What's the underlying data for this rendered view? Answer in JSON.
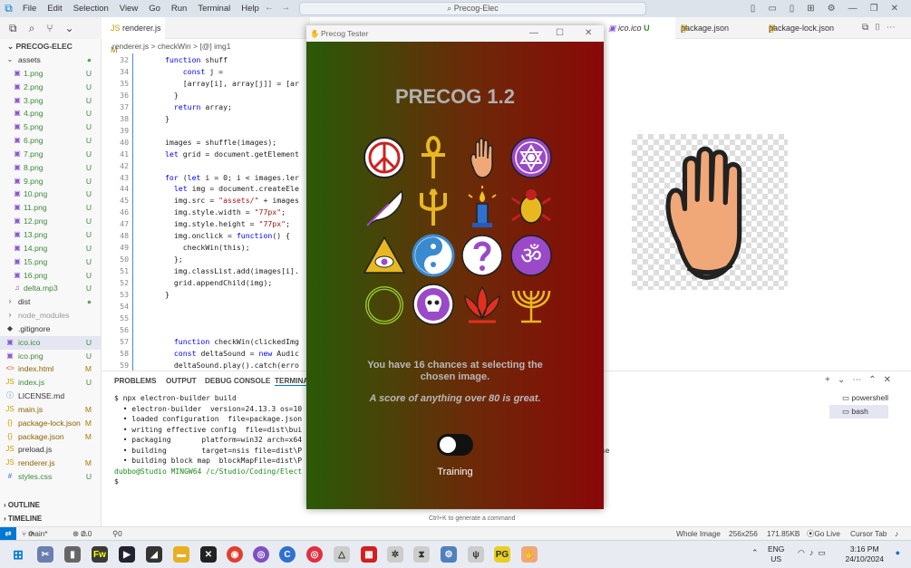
{
  "menubar": {
    "items": [
      "File",
      "Edit",
      "Selection",
      "View",
      "Go",
      "Run",
      "Terminal",
      "Help"
    ],
    "search": "Precog-Elec"
  },
  "sidebar": {
    "title": "PRECOG-ELEC",
    "items": [
      {
        "name": "assets",
        "type": "folder",
        "status": "●"
      },
      {
        "name": "1.png",
        "type": "img",
        "status": "U"
      },
      {
        "name": "2.png",
        "type": "img",
        "status": "U"
      },
      {
        "name": "3.png",
        "type": "img",
        "status": "U"
      },
      {
        "name": "4.png",
        "type": "img",
        "status": "U"
      },
      {
        "name": "5.png",
        "type": "img",
        "status": "U"
      },
      {
        "name": "6.png",
        "type": "img",
        "status": "U"
      },
      {
        "name": "7.png",
        "type": "img",
        "status": "U"
      },
      {
        "name": "8.png",
        "type": "img",
        "status": "U"
      },
      {
        "name": "9.png",
        "type": "img",
        "status": "U"
      },
      {
        "name": "10.png",
        "type": "img",
        "status": "U"
      },
      {
        "name": "11.png",
        "type": "img",
        "status": "U"
      },
      {
        "name": "12.png",
        "type": "img",
        "status": "U"
      },
      {
        "name": "13.png",
        "type": "img",
        "status": "U"
      },
      {
        "name": "14.png",
        "type": "img",
        "status": "U"
      },
      {
        "name": "15.png",
        "type": "img",
        "status": "U"
      },
      {
        "name": "16.png",
        "type": "img",
        "status": "U"
      },
      {
        "name": "delta.mp3",
        "type": "music",
        "status": "U"
      },
      {
        "name": "dist",
        "type": "folder2",
        "status": "●"
      },
      {
        "name": "node_modules",
        "type": "folder2",
        "status": ""
      },
      {
        "name": ".gitignore",
        "type": "git",
        "status": ""
      },
      {
        "name": "ico.ico",
        "type": "img",
        "status": "U"
      },
      {
        "name": "ico.png",
        "type": "img",
        "status": "U"
      },
      {
        "name": "index.html",
        "type": "html",
        "status": "M"
      },
      {
        "name": "index.js",
        "type": "js",
        "status": "U"
      },
      {
        "name": "LICENSE.md",
        "type": "info",
        "status": ""
      },
      {
        "name": "main.js",
        "type": "js",
        "status": "M"
      },
      {
        "name": "package-lock.json",
        "type": "json",
        "status": "M"
      },
      {
        "name": "package.json",
        "type": "json",
        "status": "M"
      },
      {
        "name": "preload.js",
        "type": "js",
        "status": ""
      },
      {
        "name": "renderer.js",
        "type": "js",
        "status": "M"
      },
      {
        "name": "styles.css",
        "type": "css",
        "status": "U"
      }
    ],
    "outline": "OUTLINE",
    "timeline": "TIMELINE"
  },
  "editor": {
    "tab": "renderer.js",
    "tab_status": "M",
    "breadcrumb": "renderer.js > checkWin > [@] img1",
    "tip": "$",
    "lines": [
      {
        "n": "32",
        "t": "function shuff"
      },
      {
        "n": "34",
        "t": "    const j = "
      },
      {
        "n": "35",
        "t": "    [array[i], array[j]] = [ar"
      },
      {
        "n": "36",
        "t": "  }"
      },
      {
        "n": "37",
        "t": "  return array;"
      },
      {
        "n": "38",
        "t": "}"
      },
      {
        "n": "39",
        "t": ""
      },
      {
        "n": "40",
        "t": "images = shuffle(images);"
      },
      {
        "n": "41",
        "t": "let grid = document.getElement"
      },
      {
        "n": "42",
        "t": ""
      },
      {
        "n": "43",
        "t": "for (let i = 0; i < images.ler"
      },
      {
        "n": "44",
        "t": "  let img = document.createEle"
      },
      {
        "n": "45",
        "t": "  img.src = \"assets/\" + images"
      },
      {
        "n": "46",
        "t": "  img.style.width = \"77px\";"
      },
      {
        "n": "47",
        "t": "  img.style.height = \"77px\";"
      },
      {
        "n": "48",
        "t": "  img.onclick = function() {"
      },
      {
        "n": "49",
        "t": "    checkWin(this);"
      },
      {
        "n": "50",
        "t": "  };"
      },
      {
        "n": "51",
        "t": "  img.classList.add(images[i]."
      },
      {
        "n": "52",
        "t": "  grid.appendChild(img);"
      },
      {
        "n": "53",
        "t": "}"
      },
      {
        "n": "54",
        "t": ""
      },
      {
        "n": "55",
        "t": ""
      },
      {
        "n": "56",
        "t": ""
      },
      {
        "n": "57",
        "t": "  function checkWin(clickedImg"
      },
      {
        "n": "58",
        "t": "  const deltaSound = new Audic"
      },
      {
        "n": "59",
        "t": "  deltaSound.play().catch(erro"
      }
    ]
  },
  "right_tabs": [
    {
      "label": "ico.ico",
      "status": "U"
    },
    {
      "label": "package.json",
      "status": "M"
    },
    {
      "label": "package-lock.json",
      "status": "M"
    }
  ],
  "panel": {
    "tabs": [
      "PROBLEMS",
      "OUTPUT",
      "DEBUG CONSOLE",
      "TERMINA"
    ],
    "terminal": [
      "$ npx electron-builder build",
      "  • electron-builder  version=24.13.3 os=10",
      "  • loaded configuration  file=package.json",
      "  • writing effective config  file=dist\\bui",
      "  • packaging       platform=win32 arch=x64",
      "  • building        target=nsis file=dist\\P",
      "  • building block map  blockMapFile=dist\\P",
      "",
      "dubbo@Studio MINGW64 /c/Studio/Coding/Elect",
      "$ "
    ],
    "terminal_extra": "lse",
    "terminals": [
      "powershell",
      "bash"
    ]
  },
  "statusbar": {
    "branch": "main*",
    "errors": "0",
    "warnings": "0",
    "ports": "0",
    "view": "Whole Image",
    "dims": "256x256",
    "size": "171.85KB",
    "golive": "Go Live",
    "cursor": "Cursor Tab",
    "ctrlk": "Ctrl+K to generate a command"
  },
  "app": {
    "window_title": "Precog Tester",
    "heading": "PRECOG 1.2",
    "line1": "You have 16 chances at selecting the",
    "line2": "chosen image.",
    "line3": "A score of anything over 80 is great.",
    "toggle_label": "Training",
    "toggle_on": false
  },
  "taskbar": {
    "lang1": "ENG",
    "lang2": "US",
    "time": "3:16 PM",
    "date": "24/10/2024"
  }
}
